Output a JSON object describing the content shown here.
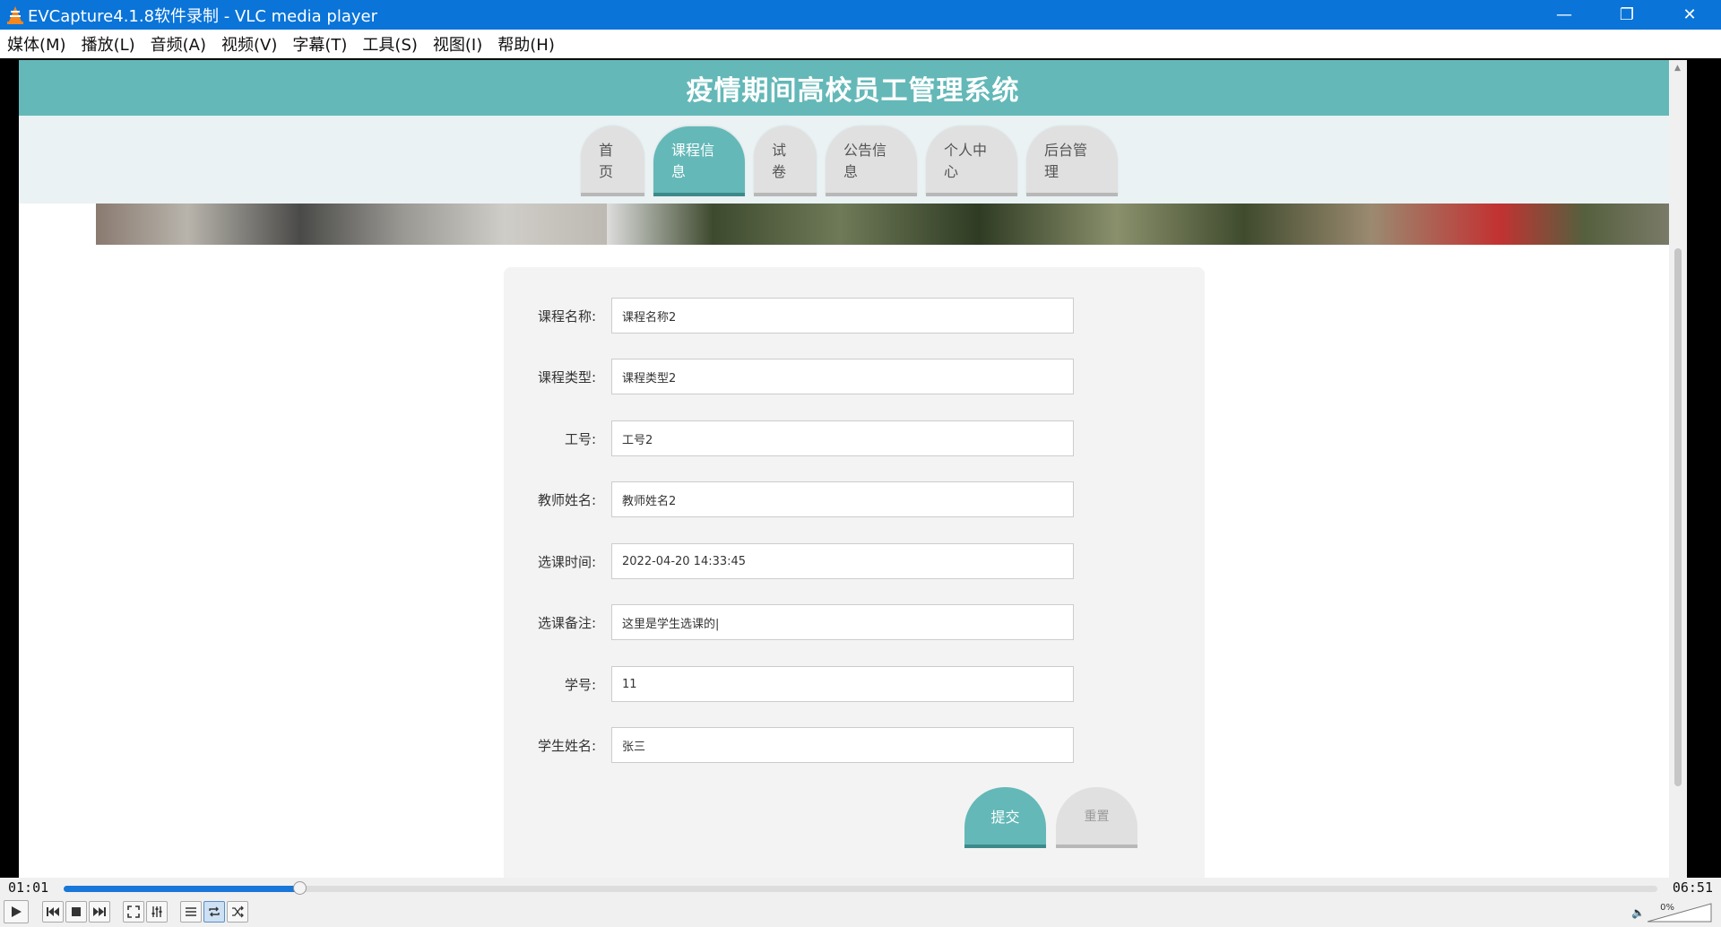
{
  "window": {
    "title": "EVCapture4.1.8软件录制 - VLC media player",
    "minimize": "—",
    "restore": "❐",
    "close": "✕"
  },
  "menu": [
    "媒体(M)",
    "播放(L)",
    "音频(A)",
    "视频(V)",
    "字幕(T)",
    "工具(S)",
    "视图(I)",
    "帮助(H)"
  ],
  "site": {
    "title": "疫情期间高校员工管理系统",
    "nav": [
      {
        "label": "首页",
        "active": false
      },
      {
        "label": "课程信息",
        "active": true
      },
      {
        "label": "试卷",
        "active": false
      },
      {
        "label": "公告信息",
        "active": false
      },
      {
        "label": "个人中心",
        "active": false
      },
      {
        "label": "后台管理",
        "active": false
      }
    ]
  },
  "form": {
    "fields": [
      {
        "label": "课程名称:",
        "value": "课程名称2"
      },
      {
        "label": "课程类型:",
        "value": "课程类型2"
      },
      {
        "label": "工号:",
        "value": "工号2"
      },
      {
        "label": "教师姓名:",
        "value": "教师姓名2"
      },
      {
        "label": "选课时间:",
        "value": "2022-04-20 14:33:45"
      },
      {
        "label": "选课备注:",
        "value": "这里是学生选课的|"
      },
      {
        "label": "学号:",
        "value": "11"
      },
      {
        "label": "学生姓名:",
        "value": "张三"
      }
    ],
    "submit": "提交",
    "reset": "重置"
  },
  "player": {
    "elapsed": "01:01",
    "total": "06:51",
    "progress": 0.148,
    "volume": "0%",
    "loop_on": true
  },
  "colors": {
    "titlebar": "#0a74d8",
    "accent": "#64b8b8",
    "seek": "#1877d8"
  }
}
